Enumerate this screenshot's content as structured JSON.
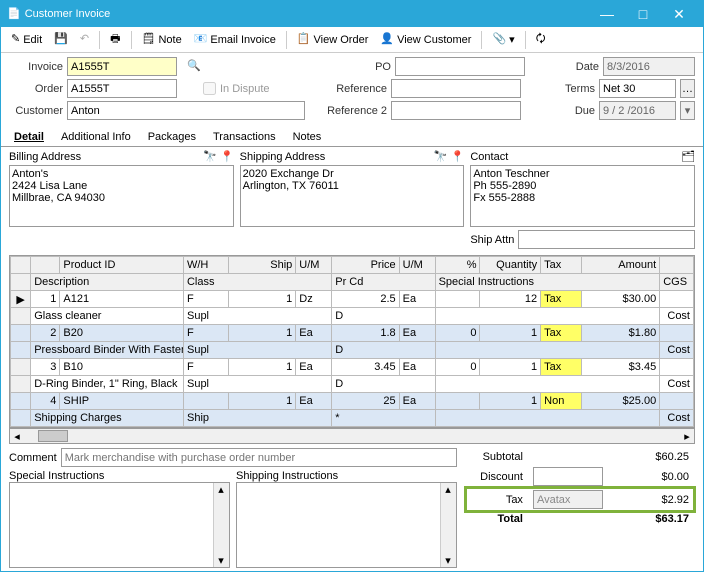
{
  "window": {
    "title": "Customer Invoice"
  },
  "toolbar": {
    "edit": "Edit",
    "note": "Note",
    "email": "Email Invoice",
    "view_order": "View Order",
    "view_customer": "View Customer"
  },
  "form": {
    "invoice_label": "Invoice",
    "invoice": "A1555T",
    "order_label": "Order",
    "order": "A1555T",
    "customer_label": "Customer",
    "customer": "Anton",
    "in_dispute_label": "In Dispute",
    "po_label": "PO",
    "reference_label": "Reference",
    "reference2_label": "Reference 2",
    "date_label": "Date",
    "date": "8/3/2016",
    "terms_label": "Terms",
    "terms": "Net 30",
    "due_label": "Due",
    "due": "9 / 2 /2016"
  },
  "tabs": {
    "detail": "Detail",
    "additional": "Additional Info",
    "packages": "Packages",
    "transactions": "Transactions",
    "notes": "Notes"
  },
  "addresses": {
    "billing_label": "Billing Address",
    "billing": "Anton's\n2424 Lisa Lane\nMillbrae, CA 94030",
    "shipping_label": "Shipping Address",
    "shipping": "2020 Exchange Dr\nArlington, TX 76011",
    "contact_label": "Contact",
    "contact": "Anton Teschner\nPh 555-2890\nFx 555-2888",
    "ship_attn_label": "Ship Attn"
  },
  "grid": {
    "headers": {
      "row": "",
      "product_id": "Product ID",
      "wh": "W/H",
      "ship": "Ship",
      "um": "U/M",
      "price": "Price",
      "um2": "U/M",
      "pct": "%",
      "quantity": "Quantity",
      "tax": "Tax",
      "amount": "Amount",
      "description": "Description",
      "class": "Class",
      "prcd": "Pr Cd",
      "special": "Special Instructions",
      "cgs": "CGS",
      "cost": "Cost"
    },
    "rows": [
      {
        "n": "1",
        "pid": "A121",
        "wh": "F",
        "ship": "1",
        "um": "Dz",
        "price": "2.5",
        "um2": "Ea",
        "pct": "",
        "qty": "12",
        "tax": "Tax",
        "amount": "$30.00",
        "desc": "Glass cleaner",
        "class": "Supl",
        "prcd": "D",
        "special": "",
        "cost": "Cost"
      },
      {
        "n": "2",
        "pid": "B20",
        "wh": "F",
        "ship": "1",
        "um": "Ea",
        "price": "1.8",
        "um2": "Ea",
        "pct": "0",
        "qty": "1",
        "tax": "Tax",
        "amount": "$1.80",
        "desc": "Pressboard Binder With Fastener",
        "class": "Supl",
        "prcd": "D",
        "special": "",
        "cost": "Cost"
      },
      {
        "n": "3",
        "pid": "B10",
        "wh": "F",
        "ship": "1",
        "um": "Ea",
        "price": "3.45",
        "um2": "Ea",
        "pct": "0",
        "qty": "1",
        "tax": "Tax",
        "amount": "$3.45",
        "desc": "D-Ring Binder, 1\" Ring, Black",
        "class": "Supl",
        "prcd": "D",
        "special": "",
        "cost": "Cost"
      },
      {
        "n": "4",
        "pid": "SHIP",
        "wh": "",
        "ship": "1",
        "um": "Ea",
        "price": "25",
        "um2": "Ea",
        "pct": "",
        "qty": "1",
        "tax": "Non",
        "amount": "$25.00",
        "desc": "Shipping Charges",
        "class": "Ship",
        "prcd": "*",
        "special": "",
        "cost": "Cost"
      }
    ]
  },
  "comment": {
    "label": "Comment",
    "placeholder": "Mark merchandise with purchase order number"
  },
  "instructions": {
    "special_label": "Special Instructions",
    "shipping_label": "Shipping Instructions"
  },
  "totals": {
    "subtotal_label": "Subtotal",
    "subtotal": "$60.25",
    "discount_label": "Discount",
    "discount": "$0.00",
    "tax_label": "Tax",
    "tax_type": "Avatax",
    "tax": "$2.92",
    "total_label": "Total",
    "total": "$63.17"
  }
}
